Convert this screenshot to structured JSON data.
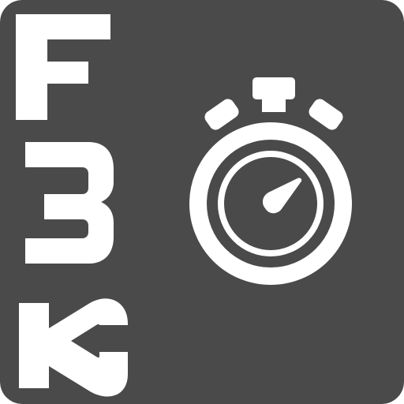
{
  "app_icon": {
    "icon_name": "f3k-stopwatch-app-icon",
    "logo_letters": [
      "F",
      "3",
      "K"
    ],
    "glyph": "stopwatch-icon",
    "colors": {
      "tile": "#4a4a4a",
      "foreground": "#ffffff"
    }
  }
}
